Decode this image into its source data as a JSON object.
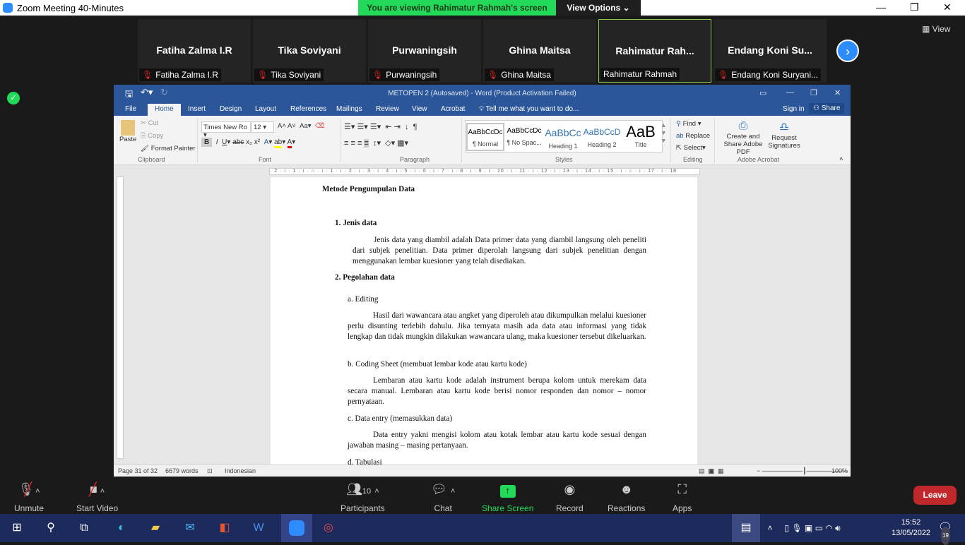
{
  "zoom": {
    "title": "Zoom Meeting 40-Minutes",
    "banner": "You are viewing Rahimatur Rahmah's screen",
    "view_options": "View Options ⌄",
    "view": "View",
    "participants": [
      {
        "tile": "Fatiha Zalma I.R",
        "label": "Fatiha Zalma I.R",
        "muted": true
      },
      {
        "tile": "Tika Soviyani",
        "label": "Tika Soviyani",
        "muted": true
      },
      {
        "tile": "Purwaningsih",
        "label": "Purwaningsih",
        "muted": true
      },
      {
        "tile": "Ghina Maitsa",
        "label": "Ghina Maitsa",
        "muted": true
      },
      {
        "tile": "Rahimatur  Rah...",
        "label": "Rahimatur Rahmah",
        "muted": false,
        "active": true
      },
      {
        "tile": "Endang  Koni  Su...",
        "label": "Endang Koni Suryani...",
        "muted": true
      }
    ],
    "toolbar": {
      "unmute": "Unmute",
      "start_video": "Start Video",
      "participants": "Participants",
      "participant_count": "10",
      "chat": "Chat",
      "share": "Share Screen",
      "record": "Record",
      "reactions": "Reactions",
      "apps": "Apps",
      "leave": "Leave"
    },
    "accent": "#2d8cff",
    "share_color": "#23d959",
    "leave_color": "#c0282c"
  },
  "word": {
    "title": "METOPEN 2 (Autosaved) - Word (Product Activation Failed)",
    "tabs": [
      "File",
      "Home",
      "Insert",
      "Design",
      "Layout",
      "References",
      "Mailings",
      "Review",
      "View",
      "Acrobat"
    ],
    "tell_me": "Tell me what you want to do...",
    "sign_in": "Sign in",
    "share": "Share",
    "clipboard": {
      "paste": "Paste",
      "cut": "Cut",
      "copy": "Copy",
      "format_painter": "Format Painter",
      "group": "Clipboard"
    },
    "font": {
      "name": "Times New Ro",
      "size": "12",
      "group": "Font"
    },
    "paragraph_group": "Paragraph",
    "styles": [
      {
        "preview": "AaBbCcDc",
        "label": "¶ Normal"
      },
      {
        "preview": "AaBbCcDc",
        "label": "¶ No Spac..."
      },
      {
        "preview": "AaBbCc",
        "label": "Heading 1"
      },
      {
        "preview": "AaBbCcD",
        "label": "Heading 2"
      },
      {
        "preview": "AaB",
        "label": "Title"
      }
    ],
    "styles_group": "Styles",
    "editing": {
      "find": "Find",
      "replace": "Replace",
      "select": "Select",
      "group": "Editing"
    },
    "acrobat": {
      "create": "Create and Share Adobe PDF",
      "request": "Request Signatures",
      "group": "Adobe Acrobat"
    },
    "ruler": "· 2 · ı · 1 · ı · ⌂ · ı · 1 · ı · 2 · ı · 3 · ı · 4 · ı · 5 · ı · 6 · ı · 7 · ı · 8 · ı · 9 · ı · 10 · ı · 11 · ı · 12 · ı · 13 · ı · 14 · ı · 15 · ı · ⌂ · ı · 17 · ı · 18",
    "status": {
      "page": "Page 31 of 32",
      "words": "6679 words",
      "language": "Indonesian",
      "zoom": "100%"
    },
    "doc": {
      "heading": "Metode Pengumpulan Data",
      "s1": "1.   Jenis data",
      "p1": "Jenis data yang diambil adalah Data primer data yang diambil langsung oleh peneliti dari subjek penelitian. Data primer diperolah langsung dari subjek penelitian dengan menggunakan lembar kuesioner yang telah disediakan.",
      "s2": "2.   Pegolahan data",
      "a": "a.   Editing",
      "pa": "Hasil dari wawancara atau angket yang diperoleh atau dikumpulkan melalui kuesioner perlu disunting terlebih dahulu. Jika ternyata masih ada data atau informasi yang tidak lengkap dan tidak mungkin dilakukan wawancara ulang,  maka kuesioner tersebut dikeluarkan.",
      "b": "b.   Coding Sheet (membuat lembar kode atau kartu kode)",
      "pb": "Lembaran atau kartu kode adalah instrument berupa kolom untuk merekam data secara manual. Lembaran atau kartu kode berisi nomor responden dan nomor – nomor pernyataan.",
      "c": "c.   Data entry (memasukkan data)",
      "pc": "Data entry yakni mengisi kolom atau kotak lembar atau kartu kode sesuai dengan jawaban masing – masing pertanyaan.",
      "d": "d.   Tabulasi"
    }
  },
  "taskbar": {
    "time": "15:52",
    "date": "13/05/2022",
    "notifications": "19"
  }
}
